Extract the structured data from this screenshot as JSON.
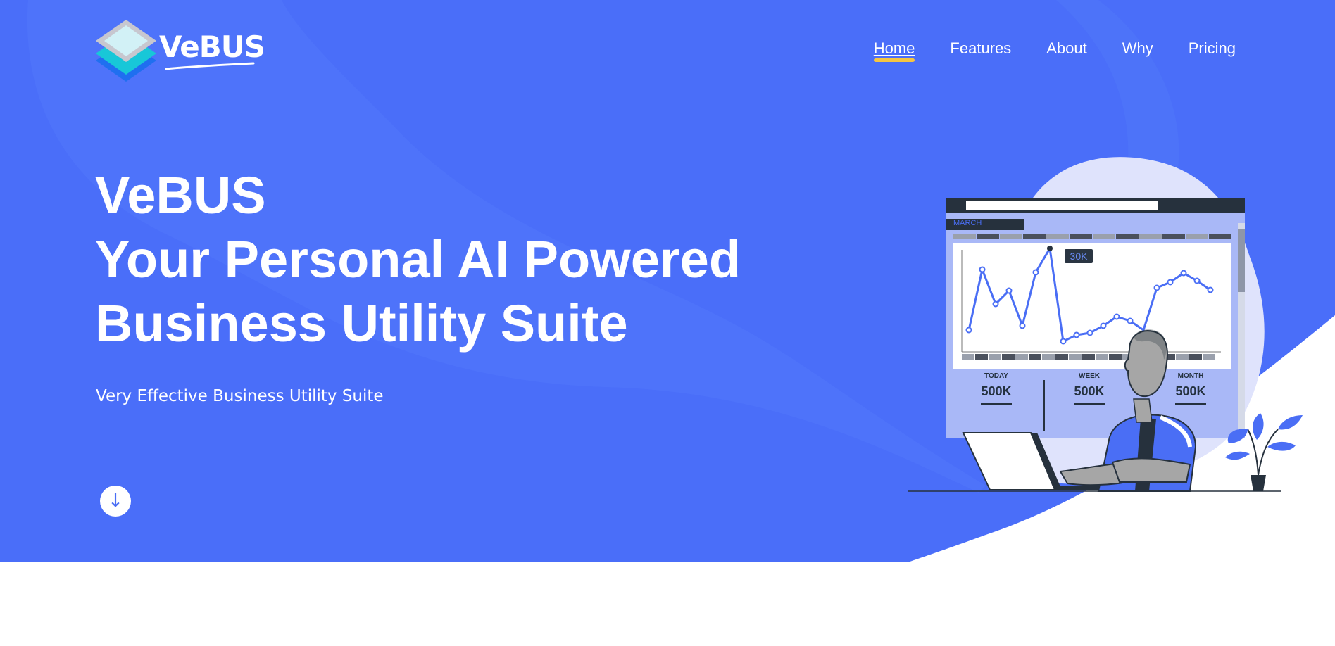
{
  "brand": {
    "name": "VeBUS",
    "accent": "#4a6ef5",
    "underline": "#f5c542"
  },
  "nav": {
    "items": [
      {
        "label": "Home",
        "active": true
      },
      {
        "label": "Features",
        "active": false
      },
      {
        "label": "About",
        "active": false
      },
      {
        "label": "Why",
        "active": false
      },
      {
        "label": "Pricing",
        "active": false
      }
    ]
  },
  "hero": {
    "title_line1": "VeBUS",
    "title_line2": "Your Personal AI Powered",
    "title_line3": "Business Utility Suite",
    "tagline": "Very Effective Business Utility Suite",
    "scroll_icon": "arrow-down-icon",
    "scroll_glyph": "↓"
  },
  "illustration": {
    "month_tab": "MARCH",
    "tooltip": "30K",
    "stats": [
      {
        "label": "TODAY",
        "value": "500K"
      },
      {
        "label": "WEEK",
        "value": "500K"
      },
      {
        "label": "MONTH",
        "value": "500K"
      }
    ]
  }
}
